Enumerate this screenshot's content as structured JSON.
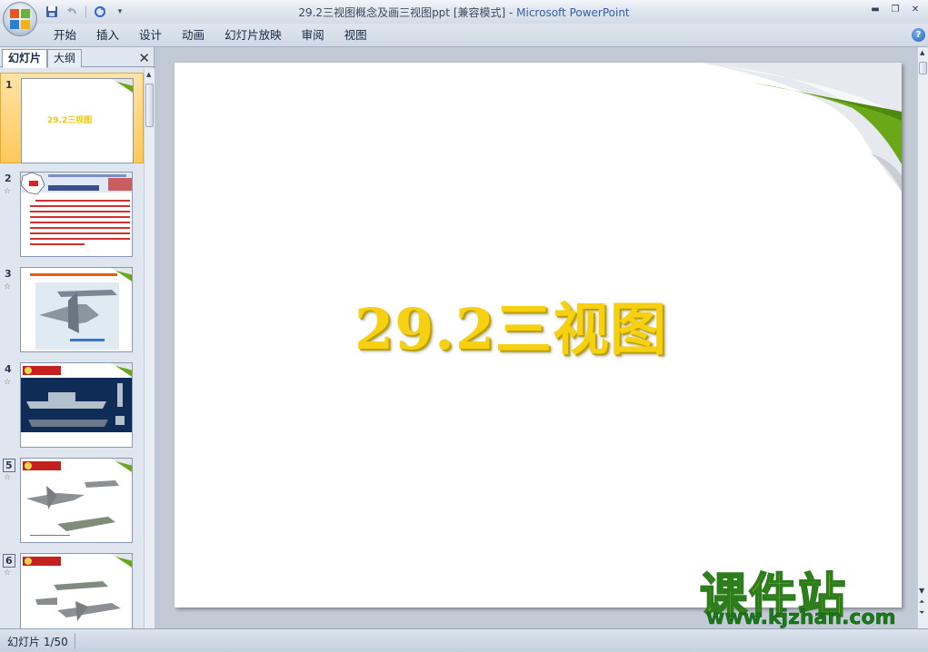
{
  "window": {
    "title_doc": "29.2三视图概念及画三视图ppt [兼容模式] - ",
    "title_app": "Microsoft PowerPoint"
  },
  "ribbon": {
    "tabs": [
      "开始",
      "插入",
      "设计",
      "动画",
      "幻灯片放映",
      "审阅",
      "视图"
    ]
  },
  "left_pane": {
    "tabs": {
      "slides": "幻灯片",
      "outline": "大纲"
    },
    "thumbnails": [
      {
        "num": "1",
        "title": "29.2三视图",
        "selected": true
      },
      {
        "num": "2",
        "title": ""
      },
      {
        "num": "3",
        "title": ""
      },
      {
        "num": "4",
        "title": ""
      },
      {
        "num": "5",
        "title": ""
      },
      {
        "num": "6",
        "title": ""
      }
    ]
  },
  "slide": {
    "title": "29.2三视图"
  },
  "watermark": {
    "site_cn": "课件站",
    "url": "www.kjzhan.com"
  },
  "status": {
    "slide_counter": "幻灯片 1/50"
  },
  "colors": {
    "title_yellow": "#f7d111",
    "accent_green": "#6aa81a",
    "selection": "#ffc95a"
  }
}
